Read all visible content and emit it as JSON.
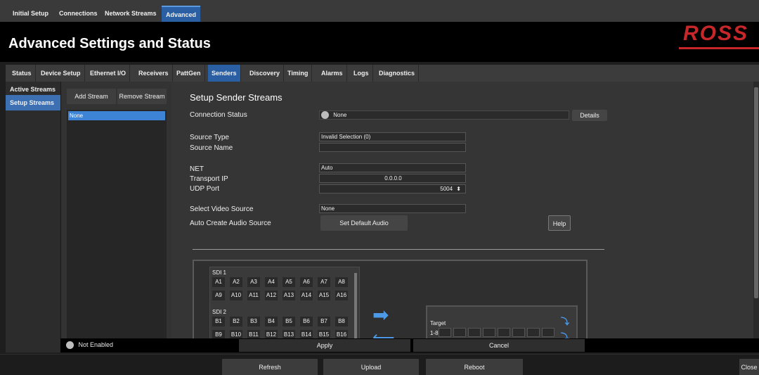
{
  "top_tabs": [
    "Initial Setup",
    "Connections",
    "Network Streams",
    "Advanced"
  ],
  "page_title": "Advanced Settings and Status",
  "logo_text": "ROSS",
  "sub_tabs": [
    "Status",
    "Device Setup",
    "Ethernet I/O",
    "Receivers",
    "PattGen",
    "Senders",
    "Discovery",
    "Timing",
    "Alarms",
    "Logs",
    "Diagnostics"
  ],
  "left_nav": [
    "Active Streams",
    "Setup Streams"
  ],
  "list_panel": {
    "add_label": "Add Stream",
    "remove_label": "Remove Stream",
    "items": [
      "None"
    ]
  },
  "form": {
    "section_title": "Setup Sender Streams",
    "connection_status_label": "Connection Status",
    "connection_status_value": "None",
    "details_label": "Details",
    "source_type_label": "Source Type",
    "source_type_value": "Invalid Selection (0)",
    "source_name_label": "Source Name",
    "source_name_value": "",
    "net_label": "NET",
    "net_value": "Auto",
    "transport_ip_label": "Transport IP",
    "transport_ip_value": "0.0.0.0",
    "udp_port_label": "UDP Port",
    "udp_port_value": "5004",
    "udp_port_spinner": "⬍",
    "video_source_label": "Select Video Source",
    "video_source_value": "None",
    "audio_source_label": "Auto Create Audio Source",
    "set_default_audio_label": "Set Default Audio",
    "help_label": "Help"
  },
  "routing": {
    "sdi1_label": "SDI 1",
    "sdi1_row1": [
      "A1",
      "A2",
      "A3",
      "A4",
      "A5",
      "A6",
      "A7",
      "A8"
    ],
    "sdi1_row2": [
      "A9",
      "A10",
      "A11",
      "A12",
      "A13",
      "A14",
      "A15",
      "A16"
    ],
    "sdi2_label": "SDI 2",
    "sdi2_row1": [
      "B1",
      "B2",
      "B3",
      "B4",
      "B5",
      "B6",
      "B7",
      "B8"
    ],
    "sdi2_row2": [
      "B9",
      "B10",
      "B11",
      "B12",
      "B13",
      "B14",
      "B15",
      "B16"
    ],
    "target_label": "Target",
    "target_row_label": "1-8"
  },
  "status_bar": {
    "status_text": "Not Enabled",
    "apply_label": "Apply",
    "cancel_label": "Cancel"
  },
  "bottom_bar": {
    "refresh_label": "Refresh",
    "upload_label": "Upload",
    "reboot_label": "Reboot",
    "close_label": "Close"
  },
  "colors": {
    "accent": "#2a5fa3",
    "list_selected": "#3d84d6",
    "logo": "#c8272a"
  }
}
